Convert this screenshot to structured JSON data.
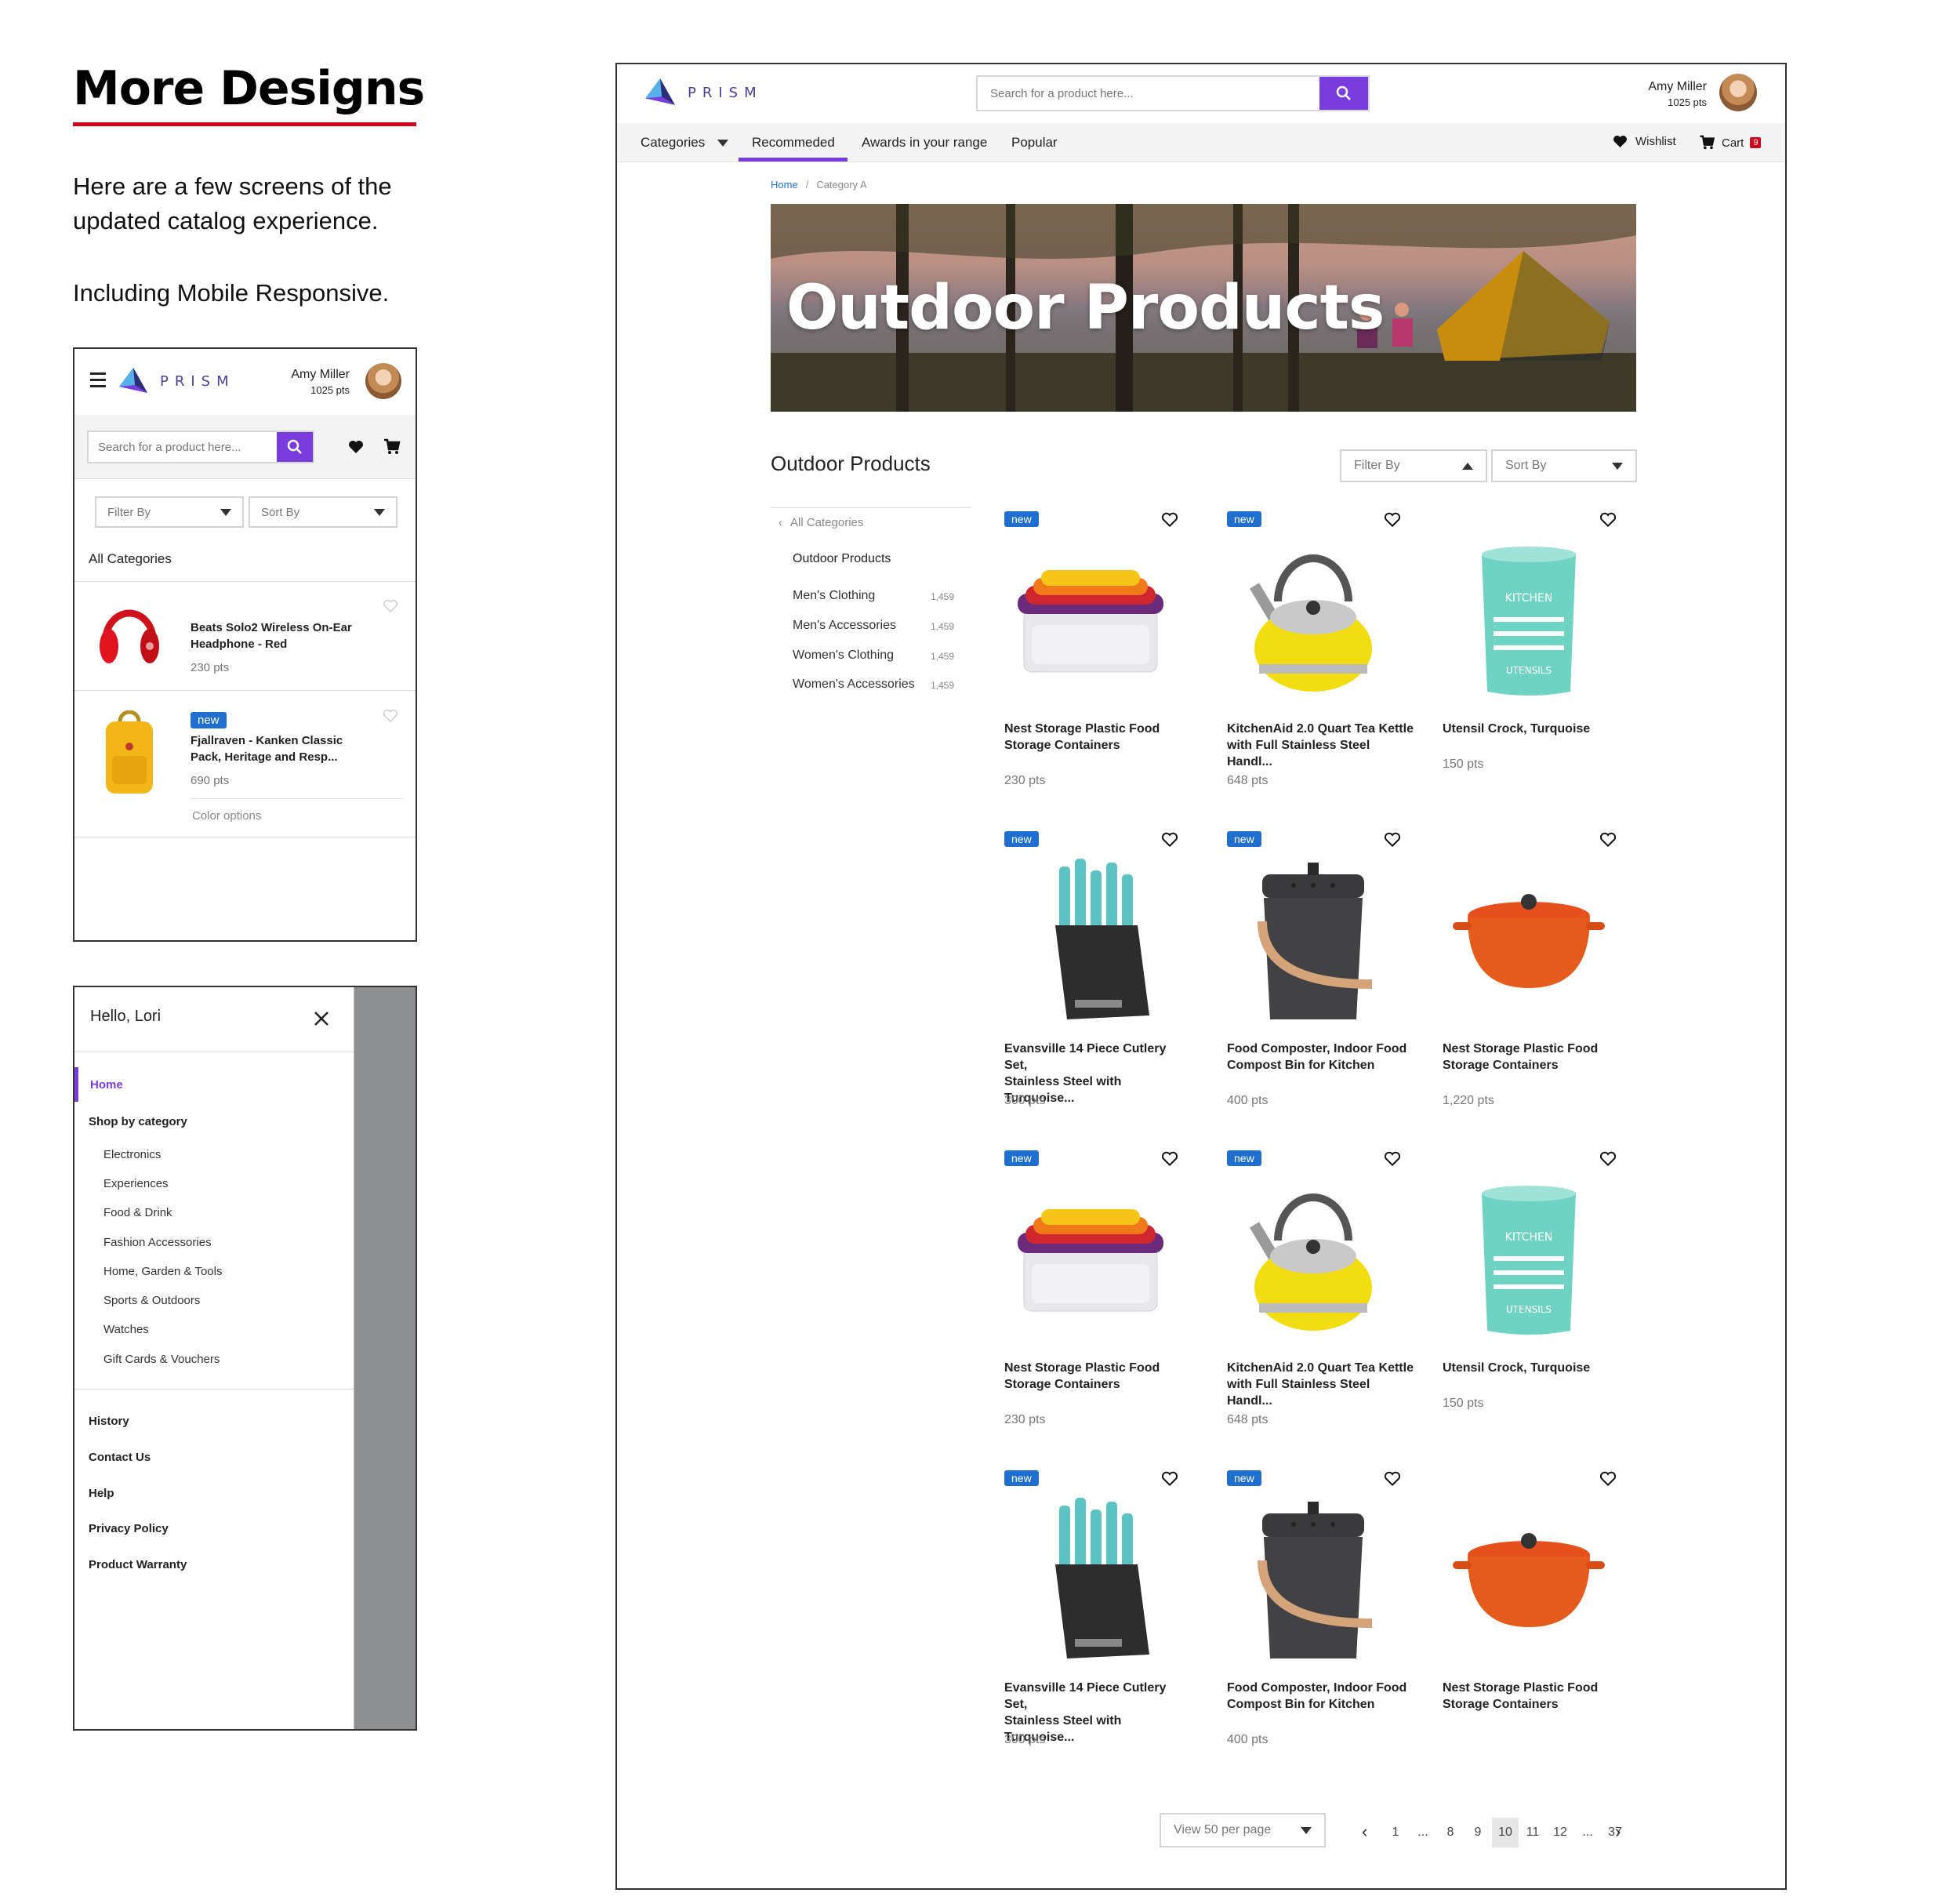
{
  "intro": {
    "title": "More Designs",
    "p1": "Here are a few screens of the updated catalog experience.",
    "p2": "Including Mobile Responsive."
  },
  "brand": {
    "logo_text": "PRISM",
    "accent": "#7a3ddd",
    "link": "#1f6fd1",
    "red": "#d0021b"
  },
  "user": {
    "name": "Amy Miller",
    "points": "1025 pts"
  },
  "search": {
    "placeholder": "Search for a product here..."
  },
  "desktop": {
    "nav": [
      {
        "label": "Categories"
      },
      {
        "label": "Recommeded"
      },
      {
        "label": "Awards in your range"
      },
      {
        "label": "Popular"
      }
    ],
    "wishlist_label": "Wishlist",
    "cart_label": "Cart",
    "cart_count": "9",
    "breadcrumb": {
      "home": "Home",
      "sep": "/",
      "current": "Category A"
    },
    "hero_title": "Outdoor Products",
    "section_title": "Outdoor Products",
    "filter_label": "Filter By",
    "sort_label": "Sort By",
    "sidebar": {
      "back_label": "All Categories",
      "current": "Outdoor Products",
      "items": [
        {
          "label": "Men's Clothing",
          "count": "1,459"
        },
        {
          "label": "Men's Accessories",
          "count": "1,459"
        },
        {
          "label": "Women's Clothing",
          "count": "1,459"
        },
        {
          "label": "Women's Accessories",
          "count": "1,459"
        }
      ]
    },
    "badge_new": "new",
    "products": [
      {
        "line1": "Nest Storage Plastic Food",
        "line2": "Storage Containers",
        "pts": "230 pts",
        "new": true,
        "img": "containers-icon"
      },
      {
        "line1": "KitchenAid 2.0 Quart Tea Kettle",
        "line2": "with Full Stainless Steel Handl...",
        "pts": "648 pts",
        "new": true,
        "img": "kettle-icon"
      },
      {
        "line1": "Utensil Crock, Turquoise",
        "line2": "",
        "pts": "150 pts",
        "new": false,
        "img": "crock-icon"
      },
      {
        "line1": "Evansville 14 Piece Cutlery Set,",
        "line2": "Stainless Steel with Turquoise...",
        "pts": "300 pts",
        "new": true,
        "img": "knife-block-icon"
      },
      {
        "line1": "Food Composter, Indoor Food",
        "line2": "Compost Bin for Kitchen",
        "pts": "400 pts",
        "new": true,
        "img": "compost-bin-icon"
      },
      {
        "line1": "Nest Storage Plastic Food",
        "line2": "Storage Containers",
        "pts": "1,220 pts",
        "new": false,
        "img": "dutch-oven-icon"
      },
      {
        "line1": "Nest Storage Plastic Food",
        "line2": "Storage Containers",
        "pts": "230 pts",
        "new": true,
        "img": "containers-icon"
      },
      {
        "line1": "KitchenAid 2.0 Quart Tea Kettle",
        "line2": "with Full Stainless Steel Handl...",
        "pts": "648 pts",
        "new": true,
        "img": "kettle-icon"
      },
      {
        "line1": "Utensil Crock, Turquoise",
        "line2": "",
        "pts": "150 pts",
        "new": false,
        "img": "crock-icon"
      },
      {
        "line1": "Evansville 14 Piece Cutlery Set,",
        "line2": "Stainless Steel with Turquoise...",
        "pts": "300 pts",
        "new": true,
        "img": "knife-block-icon"
      },
      {
        "line1": "Food Composter, Indoor Food",
        "line2": "Compost Bin for Kitchen",
        "pts": "400 pts",
        "new": true,
        "img": "compost-bin-icon"
      },
      {
        "line1": "Nest Storage Plastic Food",
        "line2": "Storage Containers",
        "pts": "",
        "new": false,
        "img": "dutch-oven-icon"
      }
    ],
    "per_page": "View 50 per page",
    "pagination": [
      "1",
      "...",
      "8",
      "9",
      "10",
      "11",
      "12",
      "...",
      "37"
    ],
    "current_page": "10"
  },
  "mobile": {
    "filter_label": "Filter By",
    "sort_label": "Sort By",
    "all_categories": "All Categories",
    "items": [
      {
        "line1": "Beats Solo2 Wireless On-Ear",
        "line2": "Headphone - Red",
        "pts": "230 pts",
        "img": "headphones-icon"
      },
      {
        "line1": "Fjallraven - Kanken Classic",
        "line2": "Pack, Heritage and Resp...",
        "pts": "690 pts",
        "img": "backpack-icon",
        "badge": "new"
      }
    ],
    "color_options": "Color options"
  },
  "menu": {
    "greeting": "Hello, Lori",
    "home": "Home",
    "shop_by": "Shop by category",
    "categories": [
      "Electronics",
      "Experiences",
      "Food & Drink",
      "Fashion Accessories",
      "Home, Garden & Tools",
      "Sports & Outdoors",
      "Watches",
      "Gift Cards & Vouchers"
    ],
    "links": [
      "History",
      "Contact Us",
      "Help",
      "Privacy Policy",
      "Product Warranty"
    ]
  }
}
